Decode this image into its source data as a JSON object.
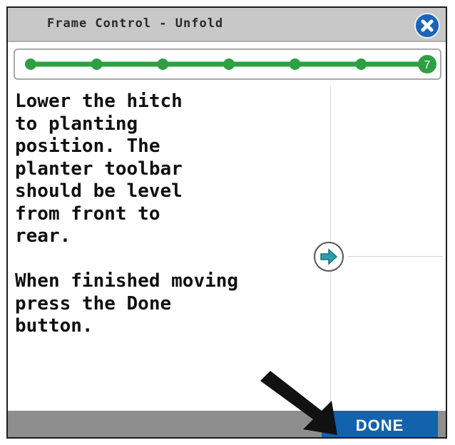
{
  "header": {
    "title": "Frame Control - Unfold",
    "close_icon": "close-icon"
  },
  "progress": {
    "current_step": 7,
    "total_steps": 7,
    "step_label": "7",
    "color": "#2ea043"
  },
  "instructions": {
    "lines": [
      "Lower the hitch",
      "to planting",
      "position. The",
      "planter toolbar",
      "should be level",
      "from front to",
      "rear.",
      "",
      "When finished moving",
      "press the Done",
      "button."
    ]
  },
  "side_panel": {
    "arrow_icon": "arrow-right-icon"
  },
  "footer": {
    "done_label": "DONE"
  },
  "colors": {
    "title_bar": "#c8c8c8",
    "accent_blue": "#1262ad",
    "footer": "#8e8e8e",
    "progress_green": "#2ea043"
  }
}
